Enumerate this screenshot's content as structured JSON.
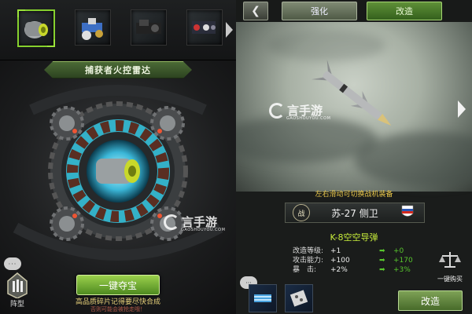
{
  "left_panel": {
    "items": [
      {
        "icon": "missile-canister-icon",
        "selected": true
      },
      {
        "icon": "turret-part-icon",
        "selected": false
      },
      {
        "icon": "engine-block-icon",
        "selected": false
      },
      {
        "icon": "mechanism-part-icon",
        "selected": false
      }
    ],
    "selected_item_name": "捕获者火控雷达",
    "one_click_button": "一键夺宝",
    "hint_main": "高品质碎片记得要尽快合成",
    "hint_sub": "否则可能会被抢走哦！",
    "chat_label": "···",
    "formation_label": "阵型"
  },
  "right_panel": {
    "tabs": [
      {
        "label": "强化",
        "active": false
      },
      {
        "label": "改造",
        "active": true
      }
    ],
    "back_icon": "back-arrow-icon",
    "swipe_hint": "左右滑动可切换战机装备",
    "plane_badge": "战",
    "plane_name": "苏-27 侧卫",
    "missile_name": "K-8空空导弹",
    "stats": [
      {
        "label": "改造等级:",
        "value": "+1",
        "bonus": "+0"
      },
      {
        "label": "攻击能力:",
        "value": "+100",
        "bonus": "+170"
      },
      {
        "label": "暴　击:",
        "value": "+2%",
        "bonus": "+3%"
      }
    ],
    "buy_label": "一键购买",
    "chat_label": "···",
    "make_button": "改造"
  },
  "watermark": {
    "text": "言手游",
    "sub": "GAOSHOUYOU.COM"
  },
  "colors": {
    "accent_green": "#86d12e",
    "missile_name": "#c7ec3b",
    "hint_gold": "#e8c64a"
  }
}
